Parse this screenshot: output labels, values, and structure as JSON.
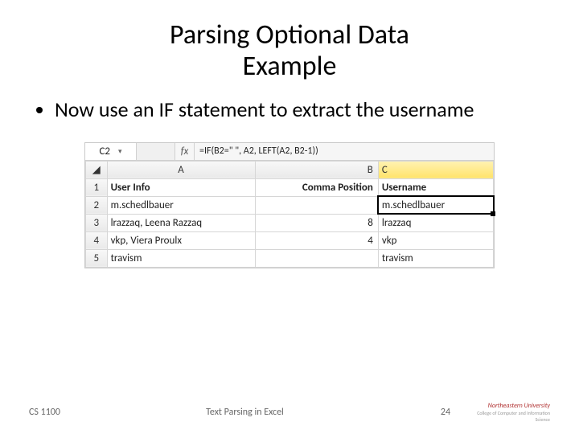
{
  "title_line1": "Parsing Optional Data",
  "title_line2": "Example",
  "bullet": "Now use an IF statement to extract the username",
  "excel": {
    "name_box": "C2",
    "fx": "fx",
    "formula": "=IF(B2=\" \", A2, LEFT(A2, B2-1))",
    "columns": {
      "a": "A",
      "b": "B",
      "c": "C"
    },
    "rows": [
      "1",
      "2",
      "3",
      "4",
      "5"
    ],
    "headers": {
      "a": "User Info",
      "b": "Comma Position",
      "c": "Username"
    },
    "data": [
      {
        "a": "m.schedlbauer",
        "b": "",
        "c": "m.schedlbauer"
      },
      {
        "a": "lrazzaq, Leena Razzaq",
        "b": "8",
        "c": "lrazzaq"
      },
      {
        "a": "vkp, Viera Proulx",
        "b": "4",
        "c": "vkp"
      },
      {
        "a": "travism",
        "b": "",
        "c": "travism"
      }
    ]
  },
  "footer": {
    "left": "CS 1100",
    "center": "Text Parsing in Excel",
    "page": "24",
    "uni": "Northeastern University",
    "sub": "College of Computer and Information Science"
  }
}
